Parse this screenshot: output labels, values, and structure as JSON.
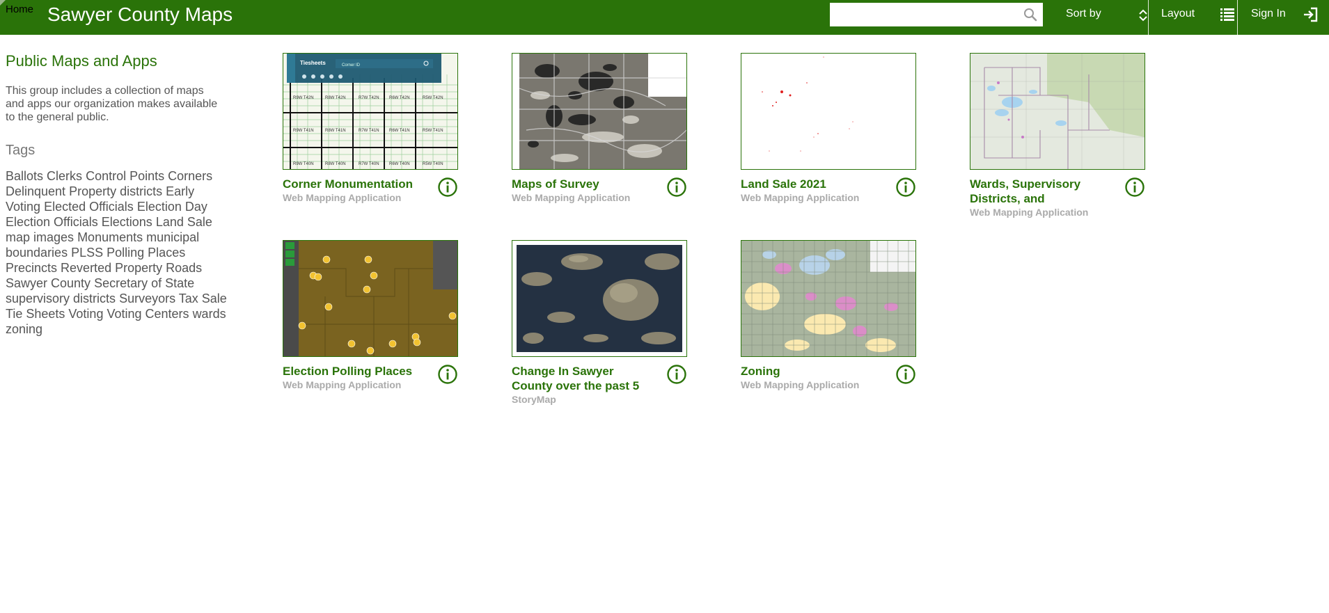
{
  "header": {
    "home_link": "Home",
    "title": "Sawyer County Maps",
    "search_placeholder": "",
    "sort_label": "Sort by",
    "layout_label": "Layout",
    "signin_label": "Sign In",
    "bg_color": "#2a7309"
  },
  "sidebar": {
    "title": "Public Maps and Apps",
    "description": "This group includes a collection of maps and apps our organization makes available to the general public.",
    "tags_heading": "Tags",
    "tags": [
      "Ballots",
      "Clerks",
      "Control Points",
      "Corners",
      "Delinquent Property",
      "districts",
      "Early Voting",
      "Elected Officials",
      "Election Day",
      "Election Officials",
      "Elections",
      "Land Sale",
      "map images",
      "Monuments",
      "municipal boundaries",
      "PLSS",
      "Polling Places",
      "Precincts",
      "Reverted Property",
      "Roads",
      "Sawyer County",
      "Secretary of State",
      "supervisory districts",
      "Surveyors",
      "Tax Sale",
      "Tie Sheets",
      "Voting",
      "Voting Centers",
      "wards",
      "zoning"
    ]
  },
  "items": [
    {
      "title": "Corner Monumentation",
      "type": "Web Mapping Application",
      "thumb_text": {
        "toolbar": "Tiesheets",
        "search": "Corner ID",
        "cells": [
          "R9W T42N",
          "R8W T42N",
          "R7W T42N",
          "R6W T42N",
          "R5W T42N",
          "R9W T41N",
          "R8W T41N",
          "R7W T41N",
          "R6W T41N",
          "R5W T41N",
          "R9W T40N",
          "R8W T40N",
          "R7W T40N",
          "R6W T40N",
          "R5W T40N"
        ]
      }
    },
    {
      "title": "Maps of Survey",
      "type": "Web Mapping Application"
    },
    {
      "title": "Land Sale 2021",
      "type": "Web Mapping Application"
    },
    {
      "title": "Wards, Supervisory Districts, and",
      "type": "Web Mapping Application"
    },
    {
      "title": "Election Polling Places",
      "type": "Web Mapping Application"
    },
    {
      "title": "Change In Sawyer County over the past 5",
      "type": "StoryMap"
    },
    {
      "title": "Zoning",
      "type": "Web Mapping Application"
    }
  ],
  "icons": {
    "search": "search-icon",
    "sort": "sort-arrows-icon",
    "layout": "list-icon",
    "signin": "sign-in-icon",
    "info": "info-icon"
  }
}
